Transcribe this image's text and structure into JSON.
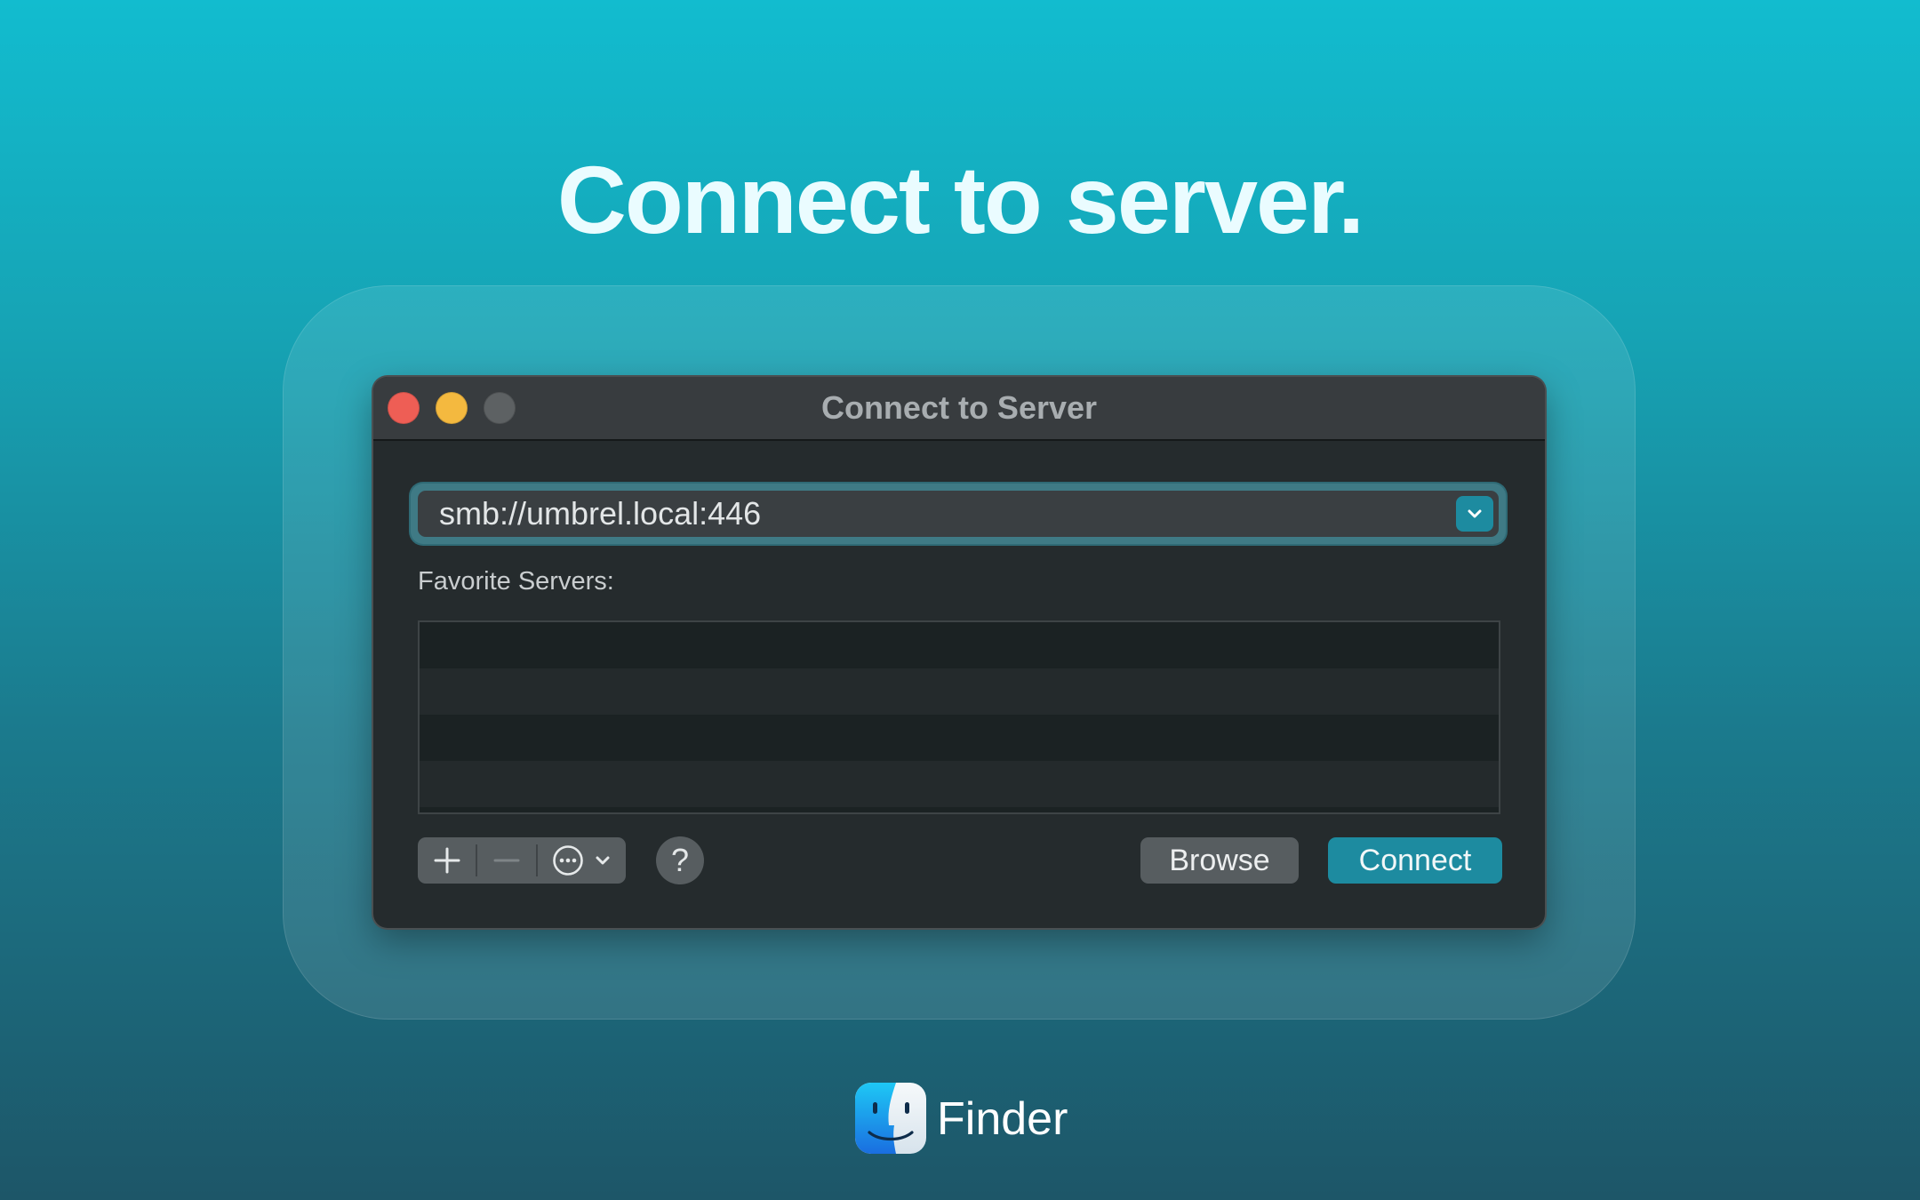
{
  "hero": {
    "title": "Connect to server."
  },
  "window": {
    "title": "Connect to Server",
    "traffic_lights": [
      "close",
      "minimize",
      "zoom"
    ]
  },
  "address": {
    "value": "smb://umbrel.local:446",
    "dropdown_icon": "chevron-down-icon"
  },
  "favorites": {
    "label": "Favorite Servers:",
    "items": []
  },
  "toolbar": {
    "add_icon": "plus-icon",
    "remove_icon": "minus-icon",
    "more_icon": "ellipsis-circle-icon",
    "help_label": "?",
    "browse_label": "Browse",
    "connect_label": "Connect"
  },
  "app": {
    "name": "Finder",
    "icon": "finder-icon"
  },
  "colors": {
    "accent": "#1d8ba0",
    "close": "#ee5e55",
    "minimize": "#f4b93f"
  }
}
